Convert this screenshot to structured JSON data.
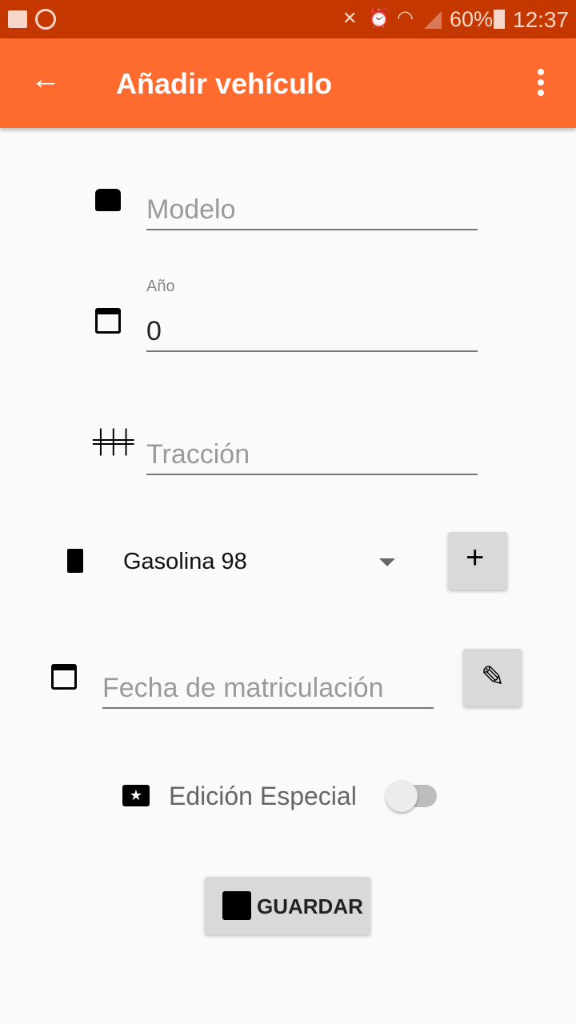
{
  "status_bar": {
    "battery": "60%",
    "time": "12:37"
  },
  "app_bar": {
    "title": "Añadir vehículo"
  },
  "form": {
    "modelo": {
      "placeholder": "Modelo",
      "value": ""
    },
    "anio": {
      "label": "Año",
      "value": "0"
    },
    "traccion": {
      "placeholder": "Tracción",
      "value": ""
    },
    "combustible": {
      "selected": "Gasolina 98"
    },
    "fecha": {
      "placeholder": "Fecha de matriculación",
      "value": ""
    },
    "edicion_especial": {
      "label": "Edición Especial",
      "checked": false
    },
    "guardar": {
      "label": "GUARDAR"
    }
  },
  "colors": {
    "status_bar": "#c43800",
    "app_bar": "#ff6b2f"
  }
}
